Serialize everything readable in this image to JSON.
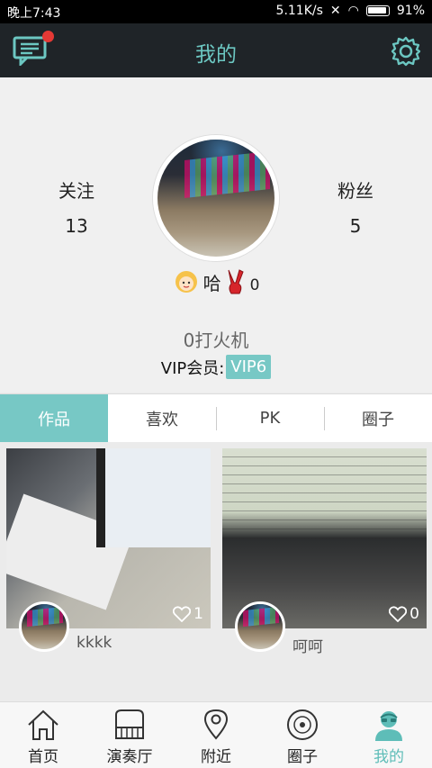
{
  "status": {
    "time": "晚上7:43",
    "speed": "5.11K/s",
    "battery": "91%"
  },
  "header": {
    "title": "我的"
  },
  "profile": {
    "follow_label": "关注",
    "follow_count": "13",
    "fans_label": "粉丝",
    "fans_count": "5",
    "name": "哈",
    "medal_count": "0",
    "signature": "0打火机",
    "vip_label": "VIP会员:",
    "vip_level": "VIP6"
  },
  "tabs": [
    {
      "label": "作品"
    },
    {
      "label": "喜欢"
    },
    {
      "label": "PK"
    },
    {
      "label": "圈子"
    }
  ],
  "works": [
    {
      "likes": "1",
      "author": "kkkk"
    },
    {
      "likes": "0",
      "author": "呵呵"
    }
  ],
  "nav": [
    {
      "label": "首页",
      "icon": "home-icon"
    },
    {
      "label": "演奏厅",
      "icon": "piano-icon"
    },
    {
      "label": "附近",
      "icon": "location-pin-icon"
    },
    {
      "label": "圈子",
      "icon": "disc-icon"
    },
    {
      "label": "我的",
      "icon": "user-icon"
    }
  ],
  "colors": {
    "accent": "#77c8c5",
    "header_bg": "#1f2428",
    "badge_red": "#e53935"
  }
}
